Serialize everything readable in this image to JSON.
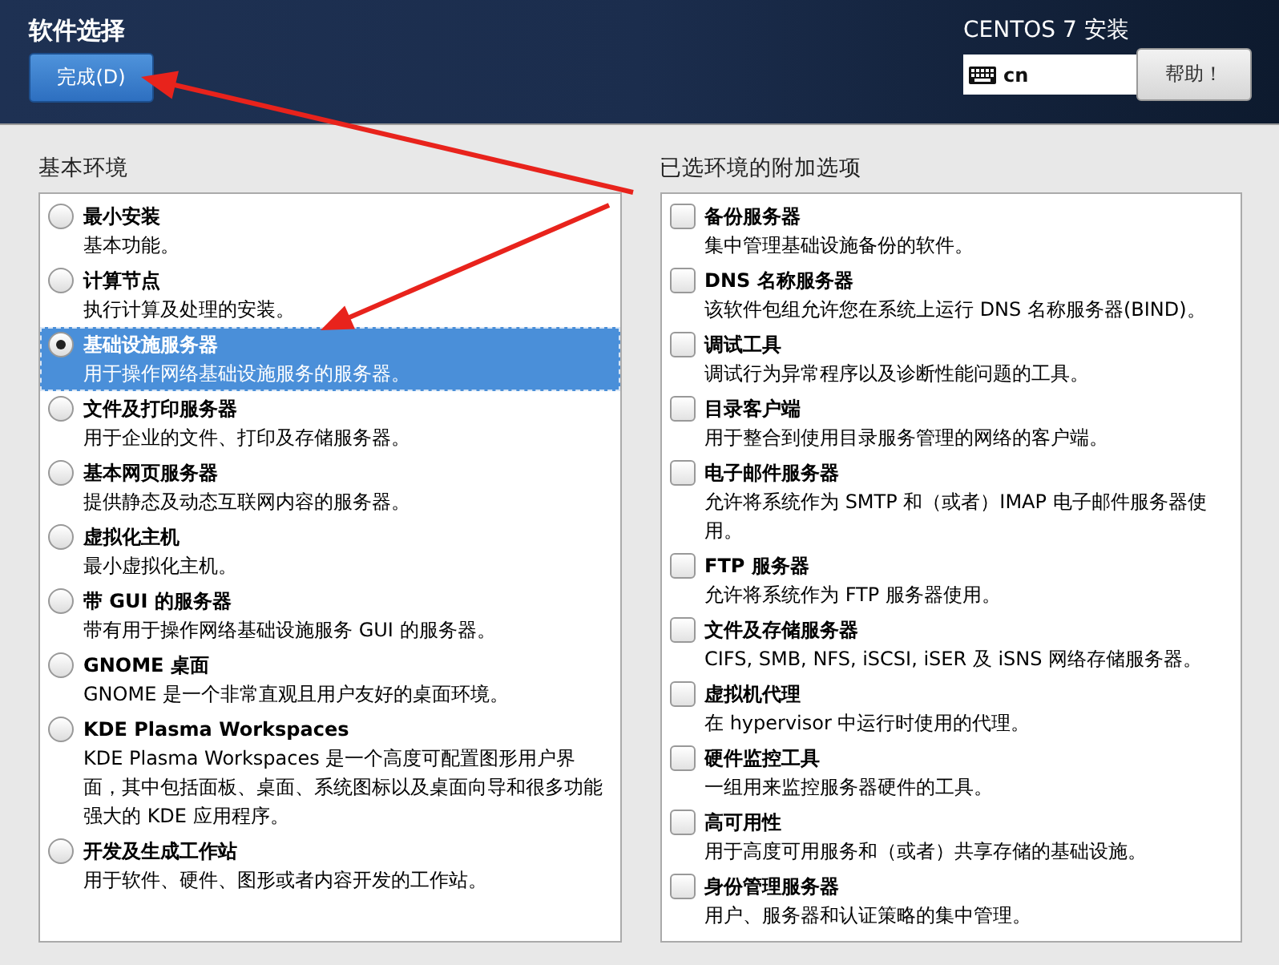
{
  "header": {
    "title": "软件选择",
    "done_button": "完成(D)",
    "product": "CENTOS 7 安装",
    "keyboard_layout": "cn",
    "help_button": "帮助！"
  },
  "environments": {
    "heading": "基本环境",
    "items": [
      {
        "name": "最小安装",
        "description": "基本功能。",
        "selected": false
      },
      {
        "name": "计算节点",
        "description": "执行计算及处理的安装。",
        "selected": false
      },
      {
        "name": "基础设施服务器",
        "description": "用于操作网络基础设施服务的服务器。",
        "selected": true
      },
      {
        "name": "文件及打印服务器",
        "description": "用于企业的文件、打印及存储服务器。",
        "selected": false
      },
      {
        "name": "基本网页服务器",
        "description": "提供静态及动态互联网内容的服务器。",
        "selected": false
      },
      {
        "name": "虚拟化主机",
        "description": "最小虚拟化主机。",
        "selected": false
      },
      {
        "name": "带 GUI 的服务器",
        "description": "带有用于操作网络基础设施服务 GUI 的服务器。",
        "selected": false
      },
      {
        "name": "GNOME 桌面",
        "description": "GNOME 是一个非常直观且用户友好的桌面环境。",
        "selected": false
      },
      {
        "name": "KDE Plasma Workspaces",
        "description": "KDE Plasma Workspaces 是一个高度可配置图形用户界面，其中包括面板、桌面、系统图标以及桌面向导和很多功能强大的 KDE 应用程序。",
        "selected": false
      },
      {
        "name": "开发及生成工作站",
        "description": "用于软件、硬件、图形或者内容开发的工作站。",
        "selected": false
      }
    ]
  },
  "addons": {
    "heading": "已选环境的附加选项",
    "items": [
      {
        "name": "备份服务器",
        "description": "集中管理基础设施备份的软件。",
        "checked": false
      },
      {
        "name": "DNS 名称服务器",
        "description": "该软件包组允许您在系统上运行 DNS 名称服务器(BIND)。",
        "checked": false
      },
      {
        "name": "调试工具",
        "description": "调试行为异常程序以及诊断性能问题的工具。",
        "checked": false
      },
      {
        "name": "目录客户端",
        "description": "用于整合到使用目录服务管理的网络的客户端。",
        "checked": false
      },
      {
        "name": "电子邮件服务器",
        "description": "允许将系统作为 SMTP 和（或者）IMAP 电子邮件服务器使用。",
        "checked": false
      },
      {
        "name": "FTP 服务器",
        "description": "允许将系统作为 FTP 服务器使用。",
        "checked": false
      },
      {
        "name": "文件及存储服务器",
        "description": "CIFS, SMB, NFS, iSCSI, iSER 及 iSNS 网络存储服务器。",
        "checked": false
      },
      {
        "name": "虚拟机代理",
        "description": "在 hypervisor 中运行时使用的代理。",
        "checked": false
      },
      {
        "name": "硬件监控工具",
        "description": "一组用来监控服务器硬件的工具。",
        "checked": false
      },
      {
        "name": "高可用性",
        "description": "用于高度可用服务和（或者）共享存储的基础设施。",
        "checked": false
      },
      {
        "name": "身份管理服务器",
        "description": "用户、服务器和认证策略的集中管理。",
        "checked": false
      }
    ]
  }
}
